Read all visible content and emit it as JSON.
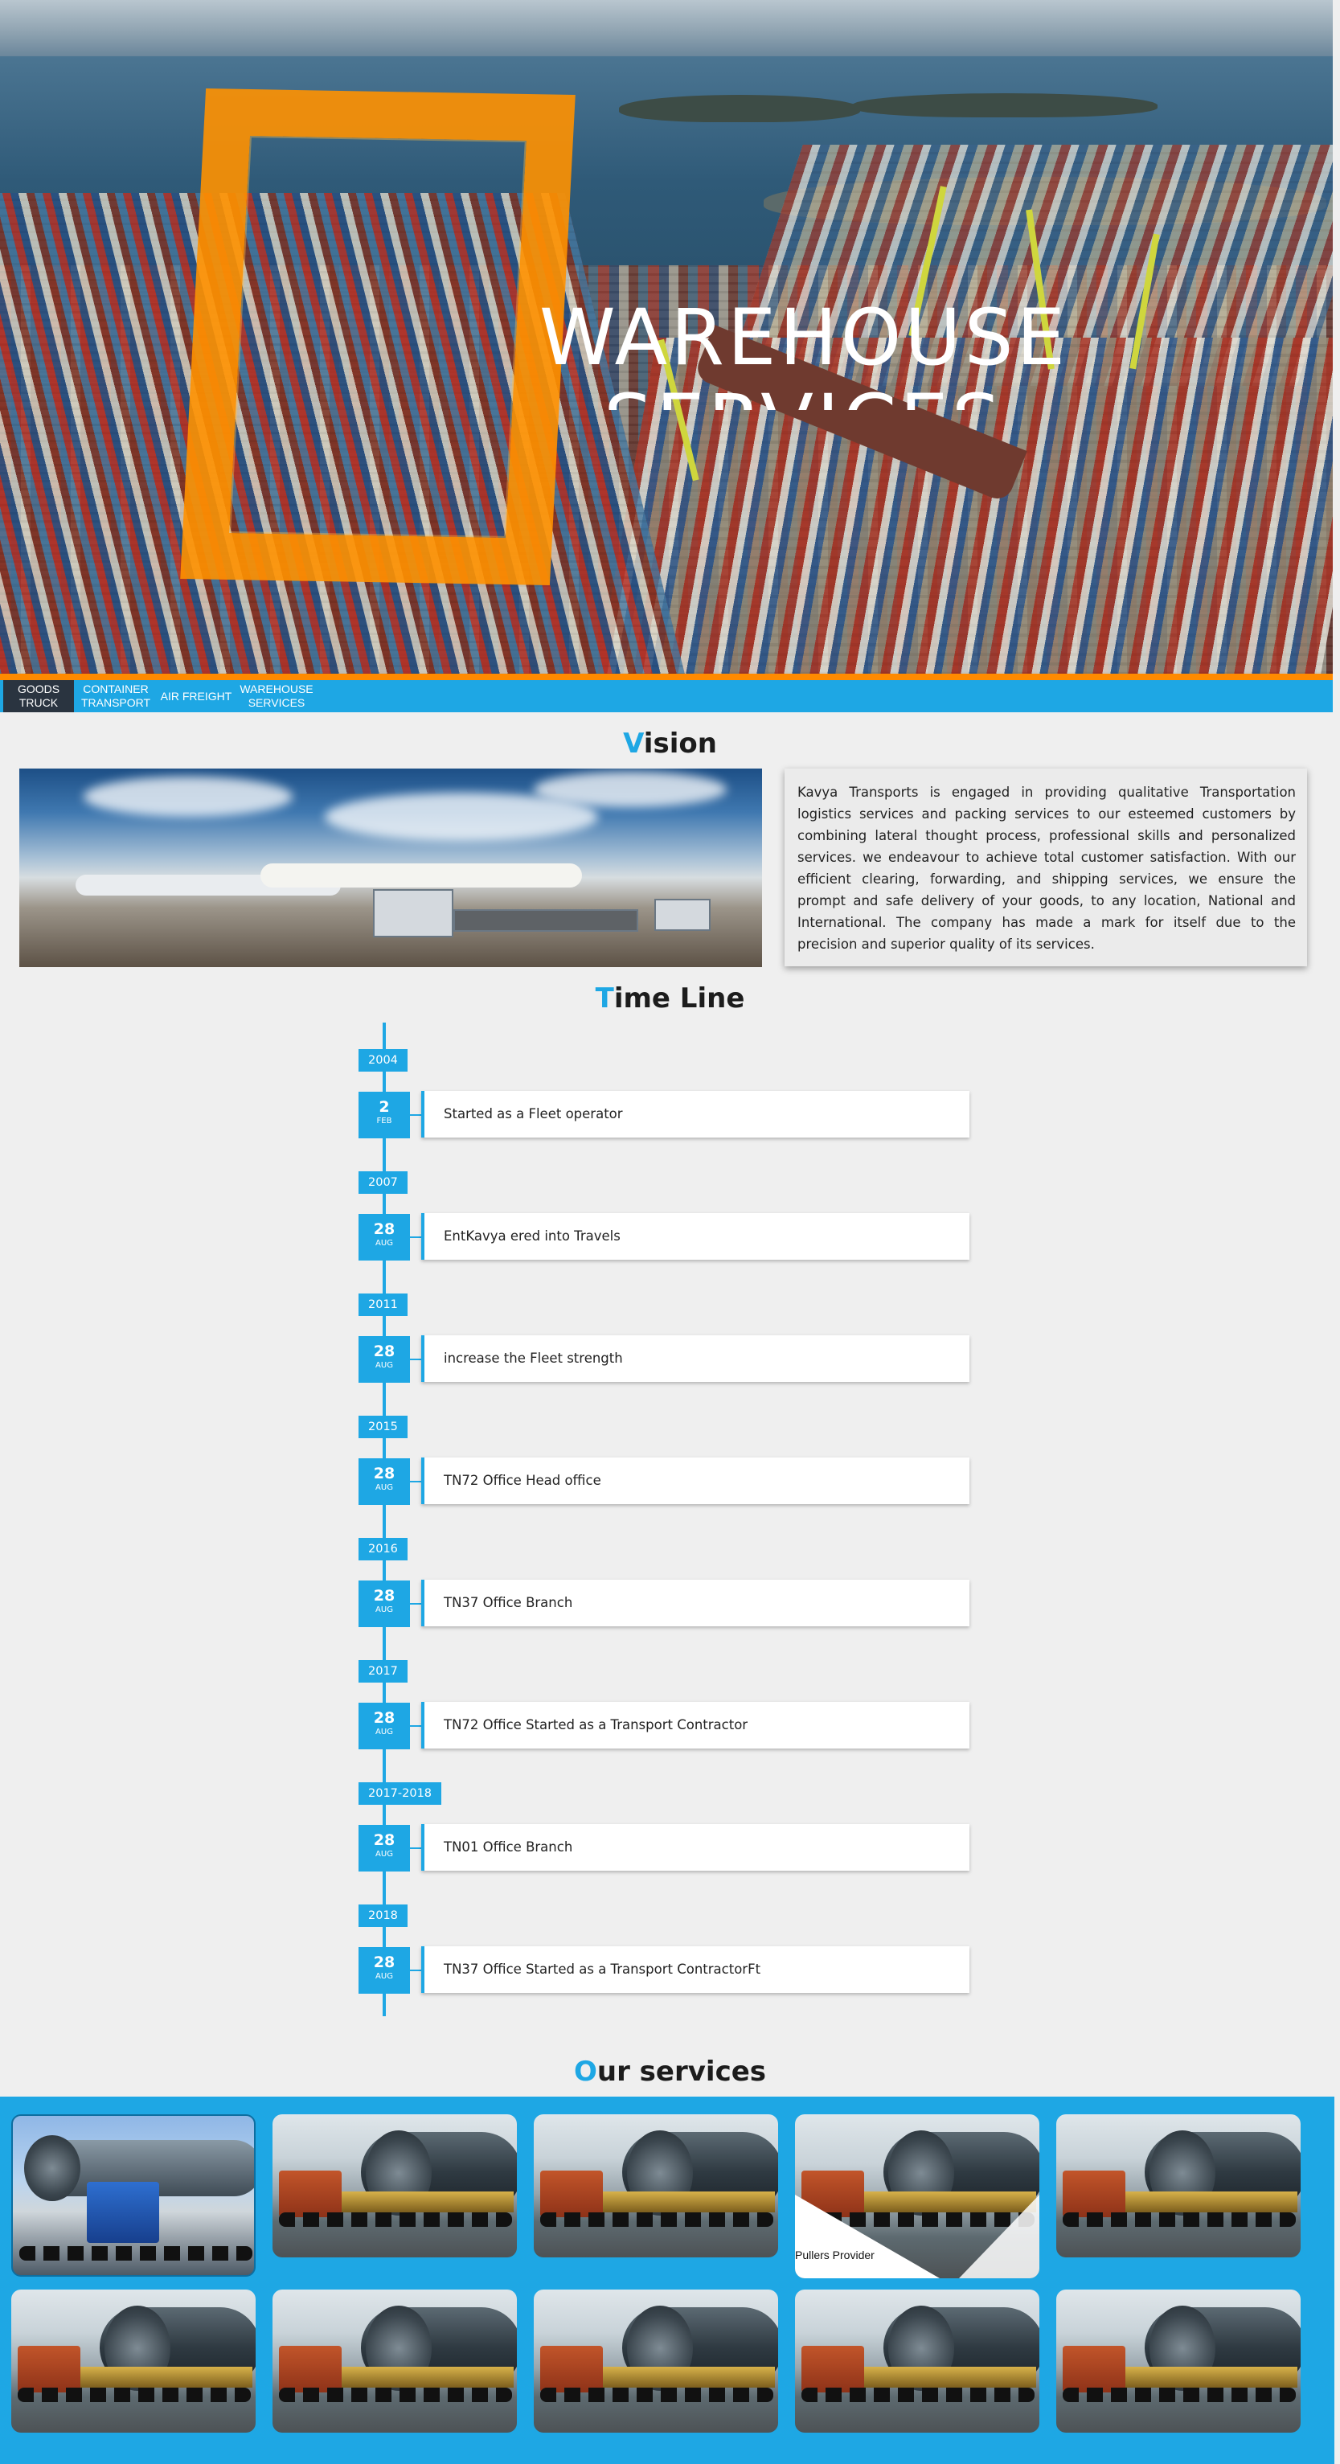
{
  "hero": {
    "title_line1": "WAREHOUSE",
    "title_line2": "SERVICES"
  },
  "nav": {
    "items": [
      {
        "label_line1": "GOODS",
        "label_line2": "TRUCK",
        "active": true
      },
      {
        "label_line1": "CONTAINER",
        "label_line2": "TRANSPORT",
        "active": false
      },
      {
        "label_line1": "AIR FREIGHT",
        "label_line2": "",
        "active": false
      },
      {
        "label_line1": "WAREHOUSE",
        "label_line2": "SERVICES",
        "active": false
      }
    ]
  },
  "vision": {
    "heading_first": "V",
    "heading_rest": "ision",
    "text": "Kavya Transports is engaged in providing qualitative Transportation logistics services and packing services to our esteemed customers by combining lateral thought process, professional skills and personalized services. we endeavour to achieve total customer satisfaction. With our efficient clearing, forwarding, and shipping services, we ensure the prompt and safe delivery of your goods, to any location, National and International. The company has made a mark for itself due to the precision and superior quality of its services."
  },
  "timeline": {
    "heading_first": "T",
    "heading_rest": "ime Line",
    "entries": [
      {
        "year": "2004",
        "day": "2",
        "month": "FEB",
        "text": "Started as a Fleet operator"
      },
      {
        "year": "2007",
        "day": "28",
        "month": "AUG",
        "text": "EntKavya ered into Travels"
      },
      {
        "year": "2011",
        "day": "28",
        "month": "AUG",
        "text": "increase the Fleet strength"
      },
      {
        "year": "2015",
        "day": "28",
        "month": "AUG",
        "text": "TN72 Office Head office"
      },
      {
        "year": "2016",
        "day": "28",
        "month": "AUG",
        "text": "TN37 Office Branch"
      },
      {
        "year": "2017",
        "day": "28",
        "month": "AUG",
        "text": "TN72 Office Started as a Transport Contractor"
      },
      {
        "year": "2017-2018",
        "day": "28",
        "month": "AUG",
        "text": "TN01 Office Branch"
      },
      {
        "year": "2018",
        "day": "28",
        "month": "AUG",
        "text": "TN37 Office Started as a Transport ContractorFt"
      }
    ]
  },
  "services": {
    "heading_first": "O",
    "heading_rest": "ur services",
    "hover_caption": "Pullers Provider"
  },
  "colors": {
    "accent_blue": "#1ea7e4",
    "accent_orange": "#ff8a00",
    "nav_active": "#2a3440"
  }
}
